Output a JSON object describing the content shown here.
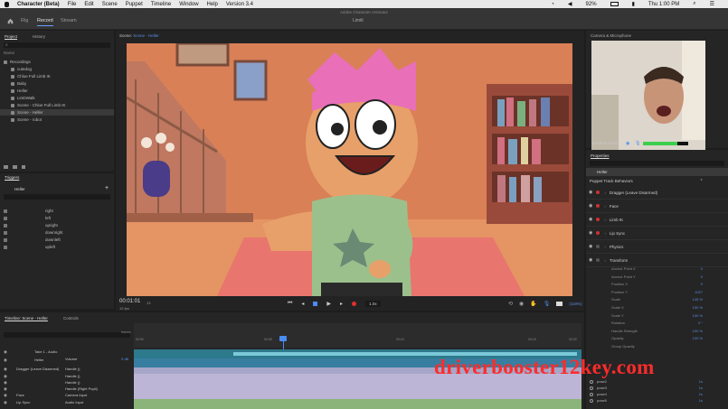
{
  "menubar": {
    "app": "Character (Beta)",
    "items": [
      "File",
      "Edit",
      "Scene",
      "Puppet",
      "Timeline",
      "Window",
      "Help",
      "Version 3.4"
    ],
    "battery": "92%",
    "clock": "Thu 1:00 PM"
  },
  "window": {
    "title": "Adobe Character Animator",
    "scene_name": "Limitl"
  },
  "modes": [
    "Rig",
    "Record",
    "Stream"
  ],
  "project_panel": {
    "tabs": [
      "Project",
      "History"
    ],
    "header": "Name",
    "items": [
      "Recordings",
      "cutedog",
      "Chloe Full Limb IK",
      "Baby",
      "Heller",
      "LimbWalk",
      "Scene - Chloe Full Limb IK",
      "Scene - Heller",
      "Scene - robot"
    ],
    "selected_index": 7
  },
  "triggers_panel": {
    "title": "Triggers",
    "puppet": "Heller",
    "add": "+",
    "items": [
      "right",
      "left",
      "upright",
      "downright",
      "downleft",
      "upleft"
    ]
  },
  "scene_panel": {
    "label": "Scene:",
    "name": "Scene - Heller"
  },
  "transport": {
    "timecode": "00:01:01",
    "frame": "13",
    "fps": "12 fps",
    "speed": "1.0x",
    "zoom": "(119%)"
  },
  "camera_panel": {
    "title": "Camera & Microphone",
    "rest_pose": "Set Rest Pose",
    "mic_level": 0.75
  },
  "properties_panel": {
    "title": "Properties",
    "puppet": "Heller",
    "section": "Puppet Track Behaviors",
    "behaviors": [
      "Dragger (Leave Disarmed)",
      "Face",
      "Limb IK",
      "Lip Sync",
      "Physics",
      "Transform"
    ],
    "transform_params": [
      {
        "name": "Anchor Point X",
        "value": "0"
      },
      {
        "name": "Anchor Point Y",
        "value": "0"
      },
      {
        "name": "Position X",
        "value": "0"
      },
      {
        "name": "Position Y",
        "value": "1027"
      },
      {
        "name": "Scale",
        "value": "145 %"
      },
      {
        "name": "Scale X",
        "value": "100 %"
      },
      {
        "name": "Scale Y",
        "value": "100 %"
      },
      {
        "name": "Rotation",
        "value": "0 °"
      },
      {
        "name": "Handle Strength",
        "value": "100 %"
      },
      {
        "name": "Opacity",
        "value": "100 %"
      },
      {
        "name": "Group Opacity",
        "value": ""
      }
    ],
    "triggers": [
      {
        "name": "pose2",
        "value": "1s"
      },
      {
        "name": "pose3",
        "value": "1s"
      },
      {
        "name": "pose4",
        "value": "1s"
      },
      {
        "name": "pose5",
        "value": "1s"
      }
    ]
  },
  "timeline_panel": {
    "tabs": [
      "Timeline: Scene - Heller",
      "Controls"
    ],
    "frames_label": "frames",
    "ruler_start": "00:00",
    "ruler_marks": [
      "00:05",
      "00:10",
      "00:15",
      "00:20"
    ],
    "playhead_label": "0:01",
    "tracks": [
      {
        "name": "Take 1 - Audio",
        "sub": "Volume",
        "value": "0 dB"
      },
      {
        "name": "Heller",
        "sub": "",
        "value": ""
      },
      {
        "name": "Dragger (Leave Disarmed)",
        "sub": "Handle ()",
        "value": ""
      },
      {
        "name": "",
        "sub": "Handle ()",
        "value": ""
      },
      {
        "name": "",
        "sub": "Handle ()",
        "value": ""
      },
      {
        "name": "",
        "sub": "Handle (Right Pupil)",
        "value": ""
      },
      {
        "name": "Face",
        "sub": "Camera Input",
        "value": ""
      },
      {
        "name": "Lip Sync",
        "sub": "Audio Input",
        "value": ""
      }
    ]
  },
  "watermark": "driverbooster12key.com"
}
